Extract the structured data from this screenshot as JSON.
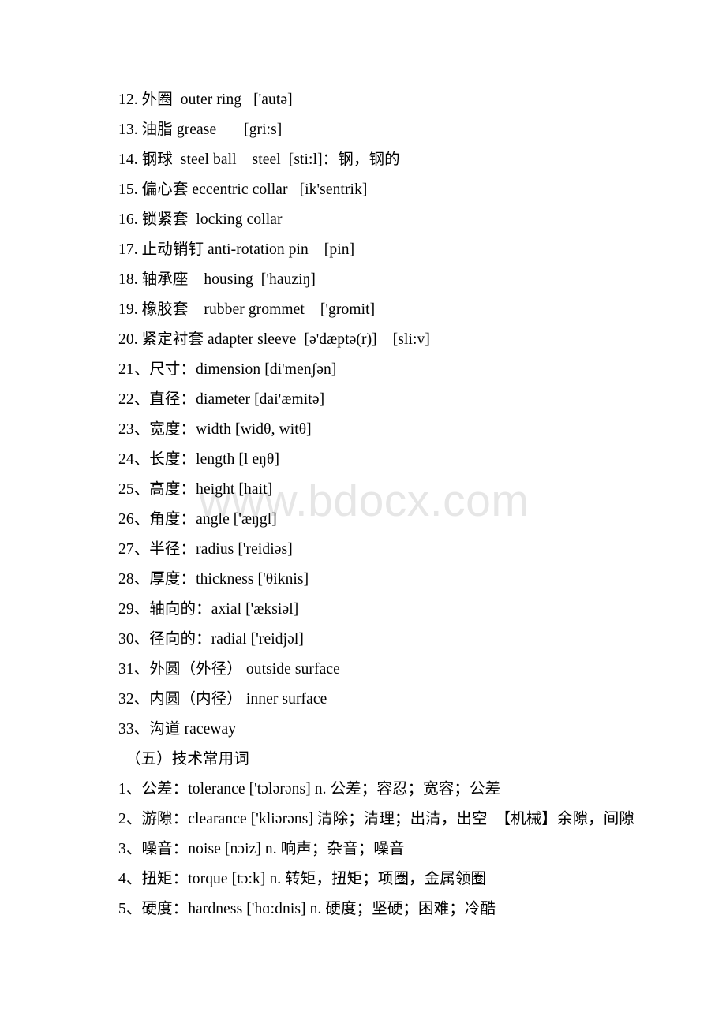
{
  "document": {
    "background_color": "#ffffff",
    "text_color": "#000000",
    "watermark": {
      "text": "www.bdocx.com",
      "color": "#e6e6e6"
    }
  },
  "lines": [
    {
      "num": "12.",
      "cn": "外圈",
      "en": "outer ring",
      "ipa": "['autə]",
      "full": "12. 外圈  outer ring   ['autə]"
    },
    {
      "num": "13.",
      "cn": "油脂",
      "en": "grease",
      "ipa": "[gri:s]",
      "full": "13. 油脂 grease       [gri:s]"
    },
    {
      "num": "14.",
      "cn": "钢球",
      "en": "steel ball",
      "ipa": "[sti:l]",
      "note": "steel [sti:l]：钢，钢的",
      "full": "14. 钢球  steel ball    steel  [sti:l]：钢，钢的"
    },
    {
      "num": "15.",
      "cn": "偏心套",
      "en": "eccentric collar",
      "ipa": "[ik'sentrik]",
      "full": "15. 偏心套 eccentric collar   [ik'sentrik]"
    },
    {
      "num": "16.",
      "cn": "锁紧套",
      "en": "locking collar",
      "ipa": "",
      "full": "16. 锁紧套  locking collar"
    },
    {
      "num": "17.",
      "cn": "止动销钉",
      "en": "anti-rotation pin",
      "ipa": "[pin]",
      "full": "17. 止动销钉 anti-rotation pin    [pin]"
    },
    {
      "num": "18.",
      "cn": "轴承座",
      "en": "housing",
      "ipa": "['hauziŋ]",
      "full": "18. 轴承座    housing  ['hauziŋ]"
    },
    {
      "num": "19.",
      "cn": "橡胶套",
      "en": "rubber grommet",
      "ipa": "['gromit]",
      "full": "19. 橡胶套    rubber grommet    ['gromit]"
    },
    {
      "num": "20.",
      "cn": "紧定衬套",
      "en": "adapter sleeve",
      "ipa": "[ə'dæptə(r)]   [sli:v]",
      "full": "20. 紧定衬套 adapter sleeve  [ə'dæptə(r)]    [sli:v]"
    },
    {
      "num": "21、",
      "cn": "尺寸：",
      "en": "dimension",
      "ipa": "[di'menʃən]",
      "full": "21、尺寸：dimension [di'menʃən]"
    },
    {
      "num": "22、",
      "cn": "直径：",
      "en": "diameter",
      "ipa": "[dai'æmitə]",
      "full": "22、直径：diameter [dai'æmitə]"
    },
    {
      "num": "23、",
      "cn": "宽度：",
      "en": "width",
      "ipa": "[widθ, witθ]",
      "full": "23、宽度：width [widθ, witθ]"
    },
    {
      "num": "24、",
      "cn": "长度：",
      "en": "length",
      "ipa": "[l eŋθ]",
      "full": "24、长度：length [l eŋθ]"
    },
    {
      "num": "25、",
      "cn": "高度：",
      "en": "height",
      "ipa": "[hait]",
      "full": "25、高度：height [hait]"
    },
    {
      "num": "26、",
      "cn": "角度：",
      "en": "angle",
      "ipa": "['æŋgl]",
      "full": "26、角度：angle ['æŋgl]"
    },
    {
      "num": "27、",
      "cn": "半径：",
      "en": "radius",
      "ipa": "['reidiəs]",
      "full": "27、半径：radius ['reidiəs]"
    },
    {
      "num": "28、",
      "cn": "厚度：",
      "en": "thickness",
      "ipa": "['θiknis]",
      "full": "28、厚度：thickness ['θiknis]"
    },
    {
      "num": "29、",
      "cn": "轴向的：",
      "en": "axial",
      "ipa": "['æksiəl]",
      "full": "29、轴向的：axial ['æksiəl]"
    },
    {
      "num": "30、",
      "cn": "径向的：",
      "en": "radial",
      "ipa": "['reidjəl]",
      "full": "30、径向的：radial ['reidjəl]"
    },
    {
      "num": "31、",
      "cn": "外圆（外径）",
      "en": "outside surface",
      "ipa": "",
      "full": "31、外圆（外径） outside surface"
    },
    {
      "num": "32、",
      "cn": "内圆（内径）",
      "en": "inner surface",
      "ipa": "",
      "full": "32、内圆（内径） inner surface"
    },
    {
      "num": "33、",
      "cn": "沟道",
      "en": "raceway",
      "ipa": "",
      "full": "33、沟道 raceway"
    }
  ],
  "section": {
    "heading": "（五）技术常用词",
    "items": [
      {
        "num": "1、",
        "cn": "公差：",
        "en": "tolerance",
        "ipa": "['tɔlərəns]",
        "pos": "n.",
        "gloss": "公差；容忍；宽容；公差",
        "full": "1、公差：tolerance ['tɔlərəns] n. 公差；容忍；宽容；公差"
      },
      {
        "num": "2、",
        "cn": "游隙：",
        "en": "clearance",
        "ipa": "['kliərəns]",
        "pos": "",
        "gloss": "清除；清理；出清，出空  【机械】余隙，间隙",
        "full": "2、游隙：clearance ['kliərəns] 清除；清理；出清，出空  【机械】余隙，间隙"
      },
      {
        "num": "3、",
        "cn": "噪音：",
        "en": "noise",
        "ipa": "[nɔiz]",
        "pos": "n.",
        "gloss": "响声；杂音；噪音",
        "full": "3、噪音：noise [nɔiz] n. 响声；杂音；噪音"
      },
      {
        "num": "4、",
        "cn": "扭矩：",
        "en": "torque",
        "ipa": "[tɔ:k]",
        "pos": "n.",
        "gloss": "转矩，扭矩；项圈，金属领圈",
        "full": "4、扭矩：torque [tɔ:k] n. 转矩，扭矩；项圈，金属领圈"
      },
      {
        "num": "5、",
        "cn": "硬度：",
        "en": "hardness",
        "ipa": "['hɑ:dnis]",
        "pos": "n.",
        "gloss": "硬度；坚硬；困难；冷酷",
        "full": "5、硬度：hardness ['hɑ:dnis] n. 硬度；坚硬；困难；冷酷"
      }
    ]
  }
}
